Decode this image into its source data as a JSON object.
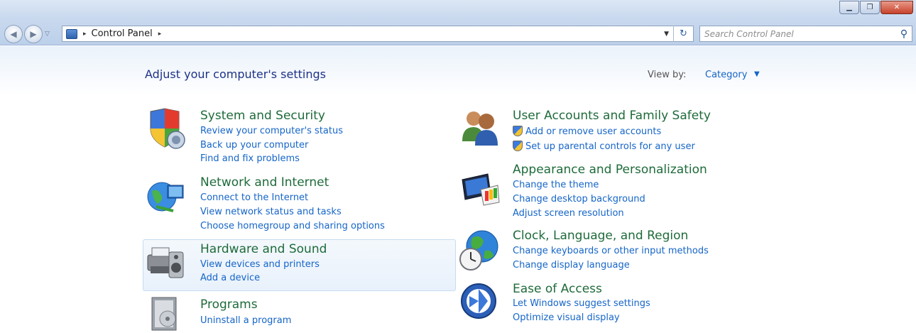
{
  "window": {
    "controls": {
      "minimize": "▁",
      "maximize": "❐",
      "close": "✕"
    }
  },
  "nav": {
    "back_glyph": "◀",
    "forward_glyph": "▶",
    "history_glyph": "▽"
  },
  "address": {
    "breadcrumbs": [
      "Control Panel"
    ],
    "separator": "▸",
    "dropdown_glyph": "▼",
    "refresh_glyph": "↻"
  },
  "search": {
    "placeholder": "Search Control Panel",
    "value": "",
    "icon_glyph": "⚲"
  },
  "main": {
    "title": "Adjust your computer's settings",
    "view_by": {
      "label": "View by:",
      "value": "Category",
      "caret": "▼"
    },
    "categories": [
      {
        "title": "System and Security",
        "icon": "shield-icon",
        "links": [
          "Review your computer's status",
          "Back up your computer",
          "Find and fix problems"
        ]
      },
      {
        "title": "Network and Internet",
        "icon": "globe-network-icon",
        "links": [
          "Connect to the Internet",
          "View network status and tasks",
          "Choose homegroup and sharing options"
        ]
      },
      {
        "title": "Hardware and Sound",
        "icon": "printer-speaker-icon",
        "links": [
          "View devices and printers",
          "Add a device"
        ]
      },
      {
        "title": "Programs",
        "icon": "programs-box-icon",
        "links": [
          "Uninstall a program"
        ]
      },
      {
        "title": "User Accounts and Family Safety",
        "icon": "users-icon",
        "links": [
          "Add or remove user accounts",
          "Set up parental controls for any user"
        ]
      },
      {
        "title": "Appearance and Personalization",
        "icon": "monitor-palette-icon",
        "links": [
          "Change the theme",
          "Change desktop background",
          "Adjust screen resolution"
        ]
      },
      {
        "title": "Clock, Language, and Region",
        "icon": "globe-clock-icon",
        "links": [
          "Change keyboards or other input methods",
          "Change display language"
        ]
      },
      {
        "title": "Ease of Access",
        "icon": "ease-of-access-icon",
        "links": [
          "Let Windows suggest settings",
          "Optimize visual display"
        ]
      }
    ]
  },
  "colors": {
    "category_title": "#1e6b3a",
    "link": "#1565c8",
    "page_title": "#1e3287"
  }
}
